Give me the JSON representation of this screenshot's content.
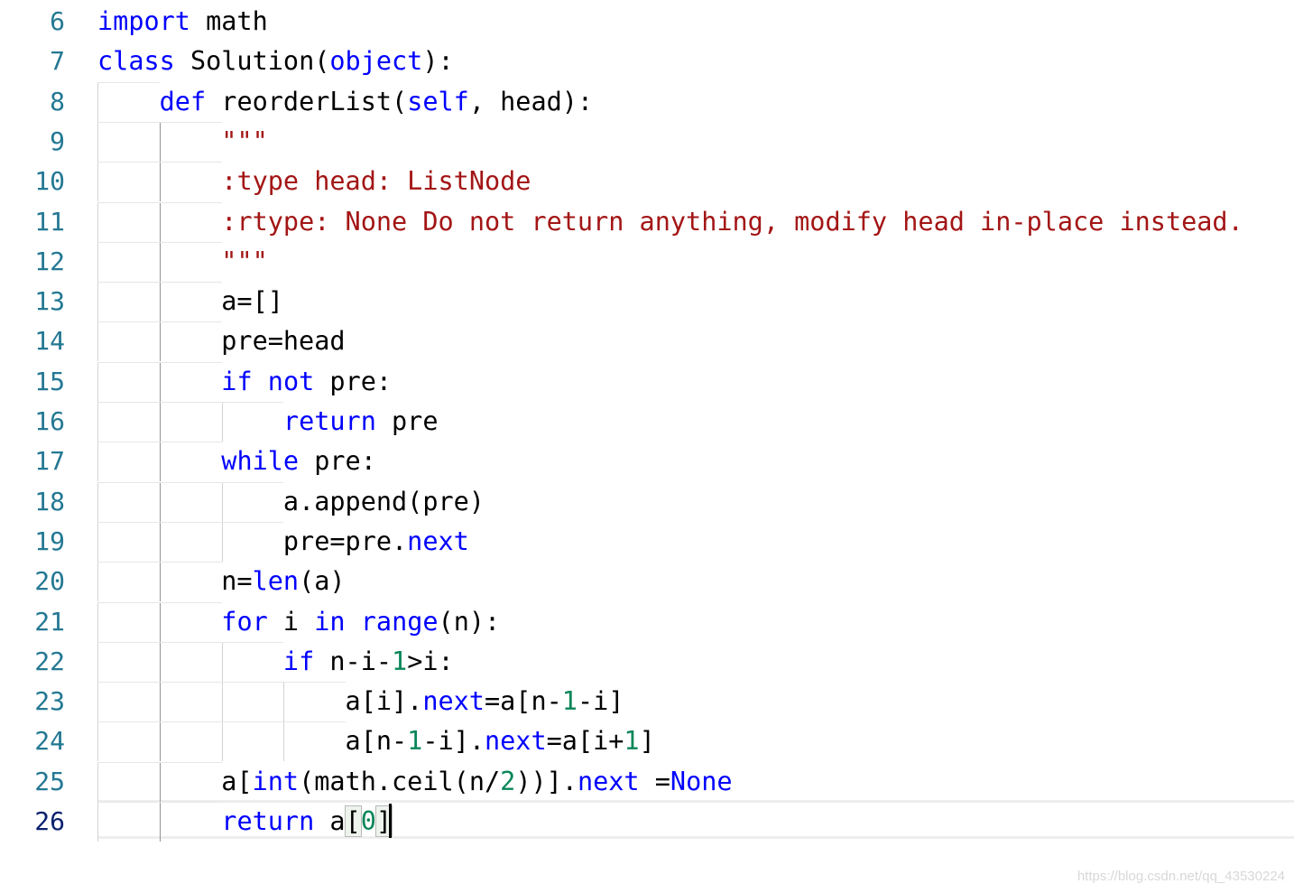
{
  "editor": {
    "lines": [
      {
        "num": "6",
        "tokens": [
          {
            "t": "import",
            "k": "kw"
          },
          {
            "t": " math",
            "k": "txt"
          }
        ]
      },
      {
        "num": "7",
        "tokens": [
          {
            "t": "class",
            "k": "kw"
          },
          {
            "t": " Solution(",
            "k": "txt"
          },
          {
            "t": "object",
            "k": "kw"
          },
          {
            "t": "):",
            "k": "txt"
          }
        ]
      },
      {
        "num": "8",
        "tokens": [
          {
            "t": "    ",
            "k": "txt"
          },
          {
            "t": "def",
            "k": "kw"
          },
          {
            "t": " reorderList(",
            "k": "txt"
          },
          {
            "t": "self",
            "k": "kw"
          },
          {
            "t": ", head):",
            "k": "txt"
          }
        ]
      },
      {
        "num": "9",
        "tokens": [
          {
            "t": "        ",
            "k": "txt"
          },
          {
            "t": "\"\"\"",
            "k": "str"
          }
        ]
      },
      {
        "num": "10",
        "tokens": [
          {
            "t": "        ",
            "k": "txt"
          },
          {
            "t": ":type head: ListNode",
            "k": "str"
          }
        ]
      },
      {
        "num": "11",
        "tokens": [
          {
            "t": "        ",
            "k": "txt"
          },
          {
            "t": ":rtype: None Do not return anything, modify head in-place instead.",
            "k": "str"
          }
        ]
      },
      {
        "num": "12",
        "tokens": [
          {
            "t": "        ",
            "k": "txt"
          },
          {
            "t": "\"\"\"",
            "k": "str"
          }
        ]
      },
      {
        "num": "13",
        "tokens": [
          {
            "t": "        a=[]",
            "k": "txt"
          }
        ]
      },
      {
        "num": "14",
        "tokens": [
          {
            "t": "        pre=head",
            "k": "txt"
          }
        ]
      },
      {
        "num": "15",
        "tokens": [
          {
            "t": "        ",
            "k": "txt"
          },
          {
            "t": "if",
            "k": "kw"
          },
          {
            "t": " ",
            "k": "txt"
          },
          {
            "t": "not",
            "k": "kw"
          },
          {
            "t": " pre:",
            "k": "txt"
          }
        ]
      },
      {
        "num": "16",
        "tokens": [
          {
            "t": "            ",
            "k": "txt"
          },
          {
            "t": "return",
            "k": "kw"
          },
          {
            "t": " pre",
            "k": "txt"
          }
        ]
      },
      {
        "num": "17",
        "tokens": [
          {
            "t": "        ",
            "k": "txt"
          },
          {
            "t": "while",
            "k": "kw"
          },
          {
            "t": " pre:",
            "k": "txt"
          }
        ]
      },
      {
        "num": "18",
        "tokens": [
          {
            "t": "            a.append(pre)",
            "k": "txt"
          }
        ]
      },
      {
        "num": "19",
        "tokens": [
          {
            "t": "            pre=pre.",
            "k": "txt"
          },
          {
            "t": "next",
            "k": "kw"
          }
        ]
      },
      {
        "num": "20",
        "tokens": [
          {
            "t": "        n=",
            "k": "txt"
          },
          {
            "t": "len",
            "k": "kw"
          },
          {
            "t": "(a)",
            "k": "txt"
          }
        ]
      },
      {
        "num": "21",
        "tokens": [
          {
            "t": "        ",
            "k": "txt"
          },
          {
            "t": "for",
            "k": "kw"
          },
          {
            "t": " i ",
            "k": "txt"
          },
          {
            "t": "in",
            "k": "kw"
          },
          {
            "t": " ",
            "k": "txt"
          },
          {
            "t": "range",
            "k": "kw"
          },
          {
            "t": "(n):",
            "k": "txt"
          }
        ]
      },
      {
        "num": "22",
        "tokens": [
          {
            "t": "            ",
            "k": "txt"
          },
          {
            "t": "if",
            "k": "kw"
          },
          {
            "t": " n-i-",
            "k": "txt"
          },
          {
            "t": "1",
            "k": "num"
          },
          {
            "t": ">i:",
            "k": "txt"
          }
        ]
      },
      {
        "num": "23",
        "tokens": [
          {
            "t": "                a[i].",
            "k": "txt"
          },
          {
            "t": "next",
            "k": "kw"
          },
          {
            "t": "=a[n-",
            "k": "txt"
          },
          {
            "t": "1",
            "k": "num"
          },
          {
            "t": "-i]",
            "k": "txt"
          }
        ]
      },
      {
        "num": "24",
        "tokens": [
          {
            "t": "                a[n-",
            "k": "txt"
          },
          {
            "t": "1",
            "k": "num"
          },
          {
            "t": "-i].",
            "k": "txt"
          },
          {
            "t": "next",
            "k": "kw"
          },
          {
            "t": "=a[i+",
            "k": "txt"
          },
          {
            "t": "1",
            "k": "num"
          },
          {
            "t": "]",
            "k": "txt"
          }
        ]
      },
      {
        "num": "25",
        "tokens": [
          {
            "t": "        a[",
            "k": "txt"
          },
          {
            "t": "int",
            "k": "kw"
          },
          {
            "t": "(math.ceil(n/",
            "k": "txt"
          },
          {
            "t": "2",
            "k": "num"
          },
          {
            "t": "))].",
            "k": "txt"
          },
          {
            "t": "next",
            "k": "kw"
          },
          {
            "t": " =",
            "k": "txt"
          },
          {
            "t": "None",
            "k": "kw"
          }
        ]
      },
      {
        "num": "26",
        "tokens": [
          {
            "t": "        ",
            "k": "txt"
          },
          {
            "t": "return",
            "k": "kw"
          },
          {
            "t": " a",
            "k": "txt"
          },
          {
            "t": "[",
            "k": "txt",
            "hl": true
          },
          {
            "t": "0",
            "k": "num"
          },
          {
            "t": "]",
            "k": "txt",
            "hl": true
          }
        ]
      }
    ],
    "active_line": "26"
  },
  "colors": {
    "keyword": "#0000ff",
    "string": "#a31515",
    "number": "#098658",
    "line_number": "#237893",
    "line_number_active": "#0b216f"
  },
  "watermark": "https://blog.csdn.net/qq_43530224"
}
